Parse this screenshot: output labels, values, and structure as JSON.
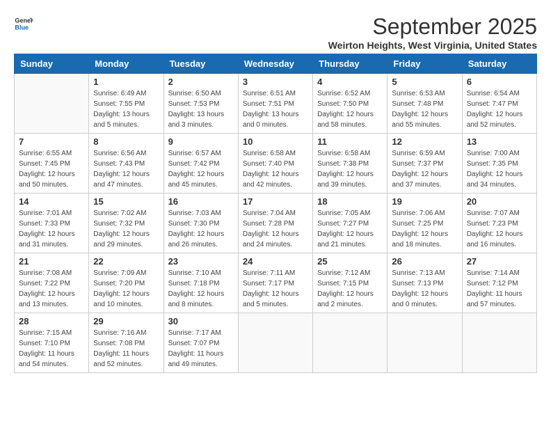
{
  "logo": {
    "line1": "General",
    "line2": "Blue"
  },
  "title": "September 2025",
  "location": "Weirton Heights, West Virginia, United States",
  "days_of_week": [
    "Sunday",
    "Monday",
    "Tuesday",
    "Wednesday",
    "Thursday",
    "Friday",
    "Saturday"
  ],
  "weeks": [
    [
      {
        "num": "",
        "sunrise": "",
        "sunset": "",
        "daylight": ""
      },
      {
        "num": "1",
        "sunrise": "Sunrise: 6:49 AM",
        "sunset": "Sunset: 7:55 PM",
        "daylight": "Daylight: 13 hours and 5 minutes."
      },
      {
        "num": "2",
        "sunrise": "Sunrise: 6:50 AM",
        "sunset": "Sunset: 7:53 PM",
        "daylight": "Daylight: 13 hours and 3 minutes."
      },
      {
        "num": "3",
        "sunrise": "Sunrise: 6:51 AM",
        "sunset": "Sunset: 7:51 PM",
        "daylight": "Daylight: 13 hours and 0 minutes."
      },
      {
        "num": "4",
        "sunrise": "Sunrise: 6:52 AM",
        "sunset": "Sunset: 7:50 PM",
        "daylight": "Daylight: 12 hours and 58 minutes."
      },
      {
        "num": "5",
        "sunrise": "Sunrise: 6:53 AM",
        "sunset": "Sunset: 7:48 PM",
        "daylight": "Daylight: 12 hours and 55 minutes."
      },
      {
        "num": "6",
        "sunrise": "Sunrise: 6:54 AM",
        "sunset": "Sunset: 7:47 PM",
        "daylight": "Daylight: 12 hours and 52 minutes."
      }
    ],
    [
      {
        "num": "7",
        "sunrise": "Sunrise: 6:55 AM",
        "sunset": "Sunset: 7:45 PM",
        "daylight": "Daylight: 12 hours and 50 minutes."
      },
      {
        "num": "8",
        "sunrise": "Sunrise: 6:56 AM",
        "sunset": "Sunset: 7:43 PM",
        "daylight": "Daylight: 12 hours and 47 minutes."
      },
      {
        "num": "9",
        "sunrise": "Sunrise: 6:57 AM",
        "sunset": "Sunset: 7:42 PM",
        "daylight": "Daylight: 12 hours and 45 minutes."
      },
      {
        "num": "10",
        "sunrise": "Sunrise: 6:58 AM",
        "sunset": "Sunset: 7:40 PM",
        "daylight": "Daylight: 12 hours and 42 minutes."
      },
      {
        "num": "11",
        "sunrise": "Sunrise: 6:58 AM",
        "sunset": "Sunset: 7:38 PM",
        "daylight": "Daylight: 12 hours and 39 minutes."
      },
      {
        "num": "12",
        "sunrise": "Sunrise: 6:59 AM",
        "sunset": "Sunset: 7:37 PM",
        "daylight": "Daylight: 12 hours and 37 minutes."
      },
      {
        "num": "13",
        "sunrise": "Sunrise: 7:00 AM",
        "sunset": "Sunset: 7:35 PM",
        "daylight": "Daylight: 12 hours and 34 minutes."
      }
    ],
    [
      {
        "num": "14",
        "sunrise": "Sunrise: 7:01 AM",
        "sunset": "Sunset: 7:33 PM",
        "daylight": "Daylight: 12 hours and 31 minutes."
      },
      {
        "num": "15",
        "sunrise": "Sunrise: 7:02 AM",
        "sunset": "Sunset: 7:32 PM",
        "daylight": "Daylight: 12 hours and 29 minutes."
      },
      {
        "num": "16",
        "sunrise": "Sunrise: 7:03 AM",
        "sunset": "Sunset: 7:30 PM",
        "daylight": "Daylight: 12 hours and 26 minutes."
      },
      {
        "num": "17",
        "sunrise": "Sunrise: 7:04 AM",
        "sunset": "Sunset: 7:28 PM",
        "daylight": "Daylight: 12 hours and 24 minutes."
      },
      {
        "num": "18",
        "sunrise": "Sunrise: 7:05 AM",
        "sunset": "Sunset: 7:27 PM",
        "daylight": "Daylight: 12 hours and 21 minutes."
      },
      {
        "num": "19",
        "sunrise": "Sunrise: 7:06 AM",
        "sunset": "Sunset: 7:25 PM",
        "daylight": "Daylight: 12 hours and 18 minutes."
      },
      {
        "num": "20",
        "sunrise": "Sunrise: 7:07 AM",
        "sunset": "Sunset: 7:23 PM",
        "daylight": "Daylight: 12 hours and 16 minutes."
      }
    ],
    [
      {
        "num": "21",
        "sunrise": "Sunrise: 7:08 AM",
        "sunset": "Sunset: 7:22 PM",
        "daylight": "Daylight: 12 hours and 13 minutes."
      },
      {
        "num": "22",
        "sunrise": "Sunrise: 7:09 AM",
        "sunset": "Sunset: 7:20 PM",
        "daylight": "Daylight: 12 hours and 10 minutes."
      },
      {
        "num": "23",
        "sunrise": "Sunrise: 7:10 AM",
        "sunset": "Sunset: 7:18 PM",
        "daylight": "Daylight: 12 hours and 8 minutes."
      },
      {
        "num": "24",
        "sunrise": "Sunrise: 7:11 AM",
        "sunset": "Sunset: 7:17 PM",
        "daylight": "Daylight: 12 hours and 5 minutes."
      },
      {
        "num": "25",
        "sunrise": "Sunrise: 7:12 AM",
        "sunset": "Sunset: 7:15 PM",
        "daylight": "Daylight: 12 hours and 2 minutes."
      },
      {
        "num": "26",
        "sunrise": "Sunrise: 7:13 AM",
        "sunset": "Sunset: 7:13 PM",
        "daylight": "Daylight: 12 hours and 0 minutes."
      },
      {
        "num": "27",
        "sunrise": "Sunrise: 7:14 AM",
        "sunset": "Sunset: 7:12 PM",
        "daylight": "Daylight: 11 hours and 57 minutes."
      }
    ],
    [
      {
        "num": "28",
        "sunrise": "Sunrise: 7:15 AM",
        "sunset": "Sunset: 7:10 PM",
        "daylight": "Daylight: 11 hours and 54 minutes."
      },
      {
        "num": "29",
        "sunrise": "Sunrise: 7:16 AM",
        "sunset": "Sunset: 7:08 PM",
        "daylight": "Daylight: 11 hours and 52 minutes."
      },
      {
        "num": "30",
        "sunrise": "Sunrise: 7:17 AM",
        "sunset": "Sunset: 7:07 PM",
        "daylight": "Daylight: 11 hours and 49 minutes."
      },
      {
        "num": "",
        "sunrise": "",
        "sunset": "",
        "daylight": ""
      },
      {
        "num": "",
        "sunrise": "",
        "sunset": "",
        "daylight": ""
      },
      {
        "num": "",
        "sunrise": "",
        "sunset": "",
        "daylight": ""
      },
      {
        "num": "",
        "sunrise": "",
        "sunset": "",
        "daylight": ""
      }
    ]
  ]
}
